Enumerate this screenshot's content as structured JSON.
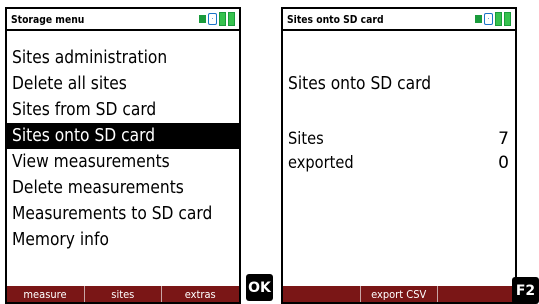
{
  "left_screen": {
    "title": "Storage menu",
    "menu_items": [
      {
        "label": "Sites administration"
      },
      {
        "label": "Delete all sites"
      },
      {
        "label": "Sites from SD card"
      },
      {
        "label": "Sites onto SD card",
        "selected": true
      },
      {
        "label": "View measurements"
      },
      {
        "label": "Delete measurements"
      },
      {
        "label": "Measurements to SD card"
      },
      {
        "label": "Memory info"
      }
    ],
    "softkeys": [
      "measure",
      "sites",
      "extras"
    ]
  },
  "right_screen": {
    "title": "Sites onto SD card",
    "heading": "Sites onto SD card",
    "rows": [
      {
        "label": "Sites",
        "value": "7"
      },
      {
        "label": "exported",
        "value": "0"
      }
    ],
    "softkeys": [
      "",
      "export CSV",
      ""
    ]
  },
  "keys": {
    "ok": "OK",
    "f2": "F2"
  },
  "status_icons": [
    "indicator-icon",
    "sd-card-icon",
    "battery-icon"
  ],
  "colors": {
    "softkey_bar": "#7a1616",
    "status_green": "#37c24e",
    "sd_blue": "#1a73c8",
    "selection": "#000000"
  }
}
